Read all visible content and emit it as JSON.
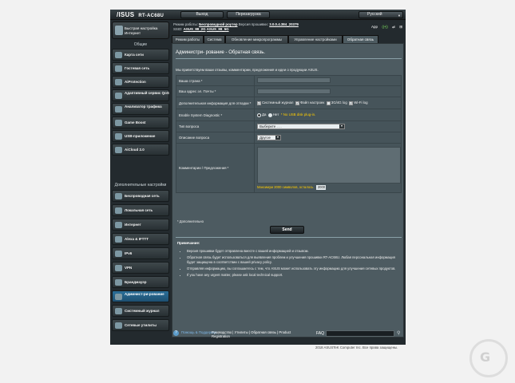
{
  "header": {
    "brand": "/ISUS",
    "model": "RT-AC68U",
    "logout_label": "Выход",
    "reboot_label": "Перезагрузка",
    "language": "Русский"
  },
  "status": {
    "mode_prefix": "Режим работы:",
    "mode_value": "Беспроводной роутер",
    "firmware_prefix": "Версия прошивки:",
    "firmware_value": "3.0.0.4.384_20379",
    "ssid_prefix": "SSID:",
    "ssid_1": "ASUS_88_2G",
    "ssid_2": "ASUS_88_5G",
    "icon_app": "App",
    "icon_wifi": "wifi-icon",
    "icon_usb": "usb-icon"
  },
  "nav": {
    "qis_label": "Быстрая настройка Интернет",
    "general_header": "Общие",
    "general_items": [
      {
        "label": "Карта сети",
        "icon": "network-map-icon"
      },
      {
        "label": "Гостевая сеть",
        "icon": "guest-network-icon"
      },
      {
        "label": "AiProtection",
        "icon": "shield-icon"
      },
      {
        "label": "Адаптивный сервис QoS",
        "icon": "qos-icon"
      },
      {
        "label": "Анализатор трафика",
        "icon": "traffic-analyzer-icon"
      },
      {
        "label": "Game Boost",
        "icon": "game-boost-icon"
      },
      {
        "label": "USB-приложение",
        "icon": "usb-app-icon"
      },
      {
        "label": "AiCloud 2.0",
        "icon": "cloud-icon"
      }
    ],
    "advanced_header": "Дополнительные настройки",
    "advanced_items": [
      {
        "label": "Беспроводная сеть",
        "icon": "wireless-icon"
      },
      {
        "label": "Локальная сеть",
        "icon": "lan-icon"
      },
      {
        "label": "Интернет",
        "icon": "globe-icon"
      },
      {
        "label": "Alexa & IFTTT",
        "icon": "alexa-icon"
      },
      {
        "label": "IPv6",
        "icon": "ipv6-icon"
      },
      {
        "label": "VPN",
        "icon": "vpn-icon"
      },
      {
        "label": "Брандмауэр",
        "icon": "firewall-icon"
      },
      {
        "label": "Админист-ри-рование",
        "icon": "admin-icon"
      },
      {
        "label": "Системный журнал",
        "icon": "syslog-icon"
      },
      {
        "label": "Сетевые утилиты",
        "icon": "tools-icon"
      }
    ]
  },
  "tabs": [
    {
      "label": "Режим работы"
    },
    {
      "label": "Система"
    },
    {
      "label": "Обновление микропрограммы"
    },
    {
      "label": "Управление настройками"
    },
    {
      "label": "Обратная связь"
    }
  ],
  "panel": {
    "title": "Администри- рование - Обратная связь.",
    "intro": "Мы приветствуем ваши отзывы, комментарии, предложения и идеи о продукции ASUS.",
    "country_label": "Ваша страна *",
    "email_label": "Ваш адрес эл. Почты *",
    "extra_label": "Дополнительная информация для отладки *",
    "extra_options": [
      "Системный журнал",
      "Файл настроек",
      "3G/4G log",
      "Wi-Fi log"
    ],
    "diag_label": "Enable System Diagnostic *",
    "diag_yes": "Да",
    "diag_no": "Нет",
    "diag_warning": "* No USB disk plug-in.",
    "question_type_label": "Тип вопроса",
    "question_type_value": "Выберите . . .",
    "description_label": "Описание вопроса",
    "description_value": "Другое",
    "comment_label": "Комментарии / Предложения *",
    "limit_text": "Максимум 2000 символов, осталось",
    "limit_count": "2000",
    "required_note": "* Дополнительно",
    "send_label": "Send",
    "notes_title": "Примечание:",
    "notes": [
      "Версия прошивки будет отправлена вместе с вашей информацией и отзывом.",
      "Обратная связь будет использоваться для выявления проблем и улучшения прошивки RT-AC68U. Любая персональная информация будет защищена в соответствии с вашей privacy policy.",
      "Отправляя информацию, вы соглашаетесь с тем, что ASUS может использовать эту информацию для улучшения сетевых продуктов.",
      "If you have any urgent matter, please ask local technical support."
    ]
  },
  "footer": {
    "help_label": "Помощь & Поддержка",
    "links": "Руководство | Утилиты | Обратная связь | Product Registration",
    "faq_label": "FAQ"
  },
  "copyright": "2018 ASUSTeK Computer Inc. Все права защищены.",
  "colors": {
    "accent": "#2b6f99",
    "panel": "#4d5b61",
    "bg": "#232a2e",
    "warning": "#ffcc00"
  }
}
